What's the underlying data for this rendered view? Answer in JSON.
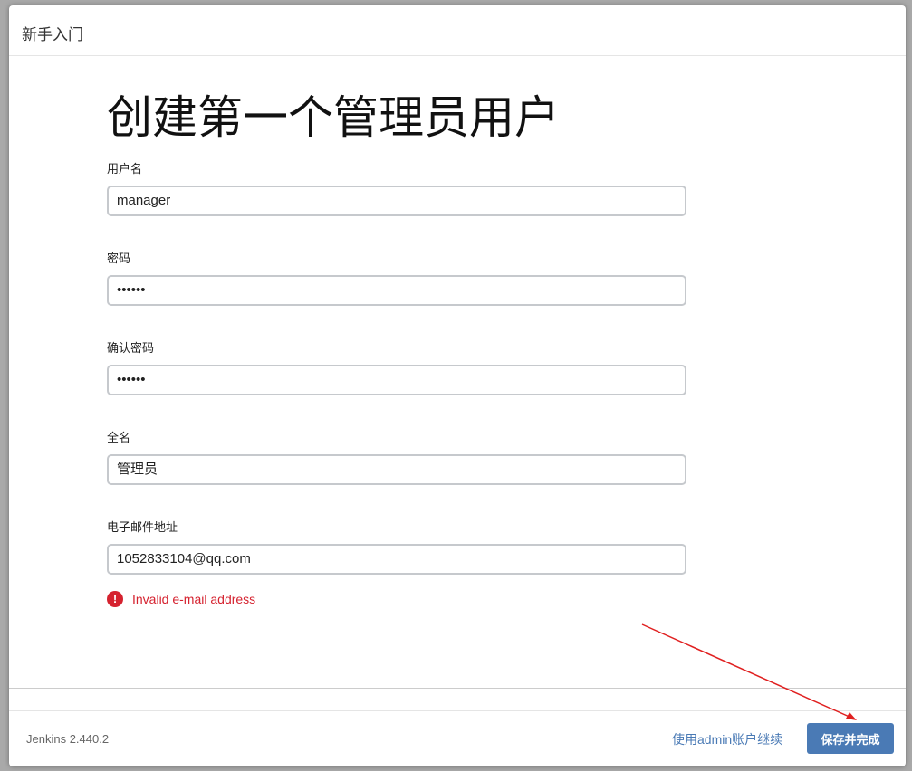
{
  "header": {
    "title": "新手入门"
  },
  "main": {
    "title": "创建第一个管理员用户",
    "fields": [
      {
        "label": "用户名",
        "value": "manager"
      },
      {
        "label": "密码",
        "value": "••••••"
      },
      {
        "label": "确认密码",
        "value": "••••••"
      },
      {
        "label": "全名",
        "value": "管理员"
      },
      {
        "label": "电子邮件地址",
        "value": "1052833104@qq.com"
      }
    ],
    "error": "Invalid e-mail address"
  },
  "footer": {
    "version": "Jenkins 2.440.2",
    "skip_link": "使用admin账户继续",
    "save_button": "保存并完成"
  },
  "colors": {
    "accent": "#4a7ab5",
    "error": "#d5222f",
    "annotation": "#e02020"
  }
}
